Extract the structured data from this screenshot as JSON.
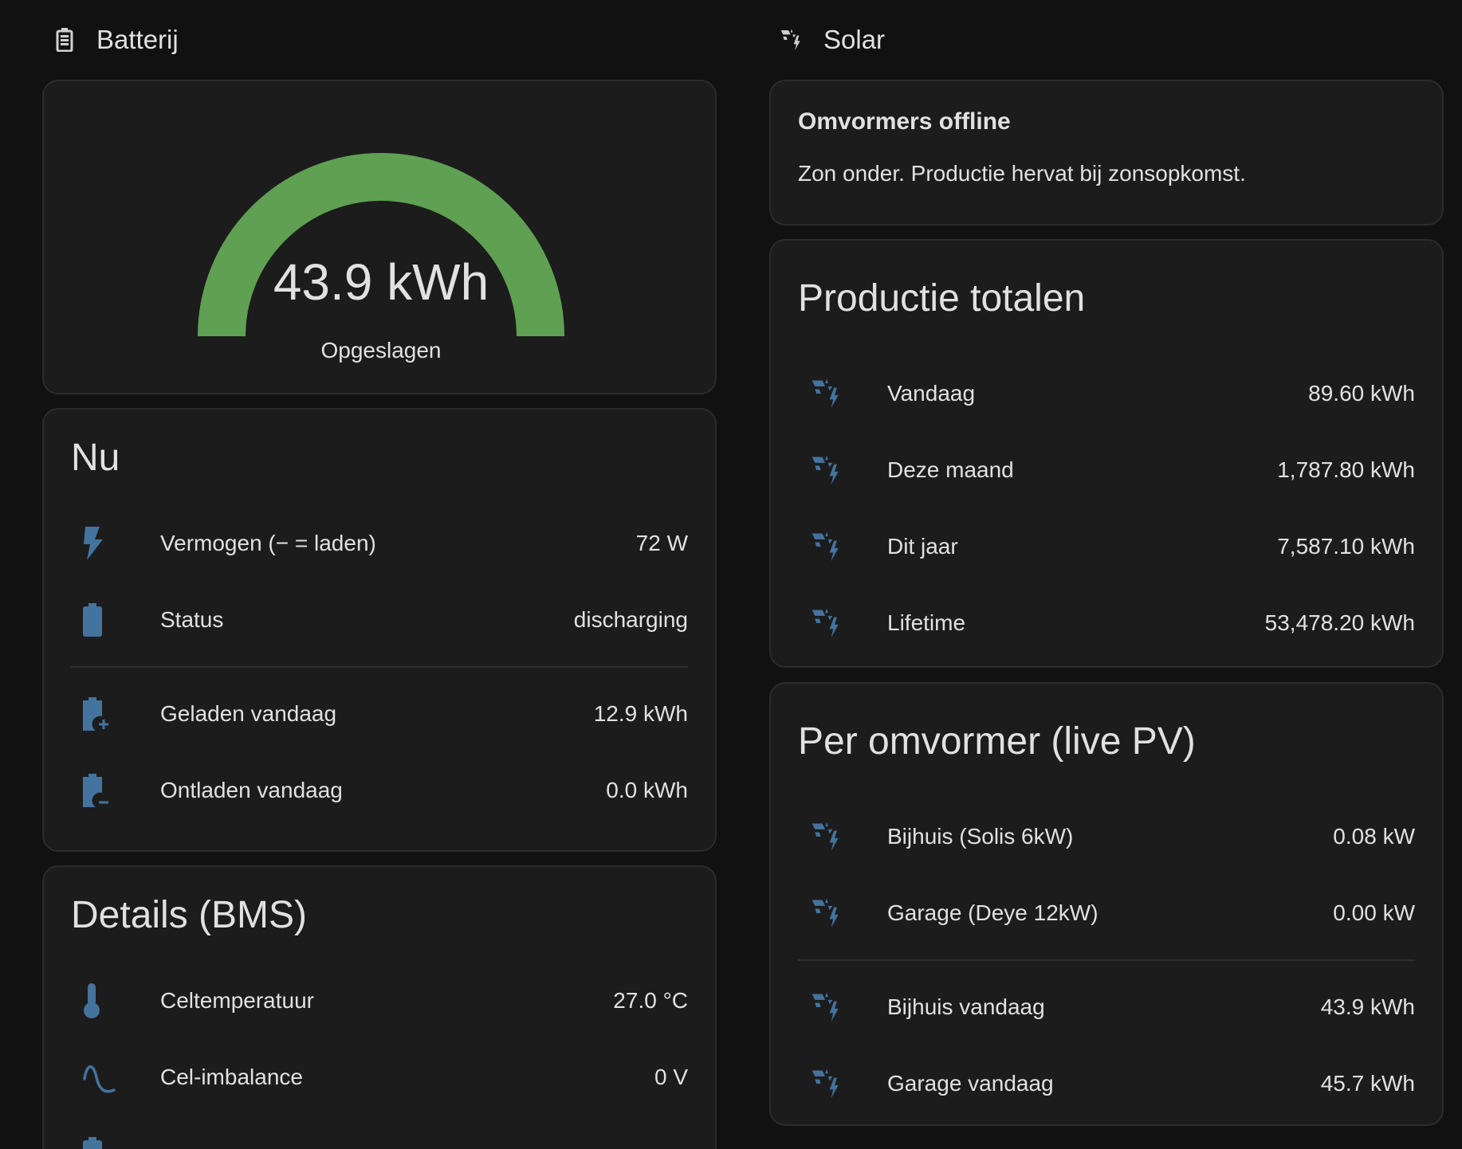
{
  "colors": {
    "background": "#111111",
    "card": "#1c1c1c",
    "icon_blue": "#44739e",
    "gauge_green": "#5fa052",
    "text": "#e1e1e1"
  },
  "battery": {
    "header": {
      "icon": "battery-icon",
      "title": "Batterij"
    },
    "gauge": {
      "value_text": "43.9 kWh",
      "label": "Opgeslagen",
      "fill_fraction": 1.0
    },
    "now": {
      "title": "Nu",
      "rows": [
        {
          "icon": "flash-icon",
          "label": "Vermogen (− = laden)",
          "value": "72 W"
        },
        {
          "icon": "battery-full-icon",
          "label": "Status",
          "value": "discharging"
        }
      ],
      "rows2": [
        {
          "icon": "battery-plus-icon",
          "label": "Geladen vandaag",
          "value": "12.9 kWh"
        },
        {
          "icon": "battery-minus-icon",
          "label": "Ontladen vandaag",
          "value": "0.0 kWh"
        }
      ]
    },
    "details": {
      "title": "Details (BMS)",
      "rows": [
        {
          "icon": "thermometer-icon",
          "label": "Celtemperatuur",
          "value": "27.0 °C"
        },
        {
          "icon": "sine-wave-icon",
          "label": "Cel-imbalance",
          "value": "0 V"
        }
      ]
    }
  },
  "solar": {
    "header": {
      "icon": "solar-power-icon",
      "title": "Solar"
    },
    "notice": {
      "title": "Omvormers offline",
      "body": "Zon onder. Productie hervat bij zonsopkomst."
    },
    "totals": {
      "title": "Productie totalen",
      "rows": [
        {
          "icon": "solar-power-icon",
          "label": "Vandaag",
          "value": "89.60 kWh"
        },
        {
          "icon": "solar-power-icon",
          "label": "Deze maand",
          "value": "1,787.80 kWh"
        },
        {
          "icon": "solar-power-icon",
          "label": "Dit jaar",
          "value": "7,587.10 kWh"
        },
        {
          "icon": "solar-power-icon",
          "label": "Lifetime",
          "value": "53,478.20 kWh"
        }
      ]
    },
    "inverters": {
      "title": "Per omvormer (live PV)",
      "rows": [
        {
          "icon": "solar-power-icon",
          "label": "Bijhuis (Solis 6kW)",
          "value": "0.08 kW"
        },
        {
          "icon": "solar-power-icon",
          "label": "Garage (Deye 12kW)",
          "value": "0.00 kW"
        }
      ],
      "rows2": [
        {
          "icon": "solar-power-icon",
          "label": "Bijhuis vandaag",
          "value": "43.9 kWh"
        },
        {
          "icon": "solar-power-icon",
          "label": "Garage vandaag",
          "value": "45.7 kWh"
        }
      ]
    }
  }
}
